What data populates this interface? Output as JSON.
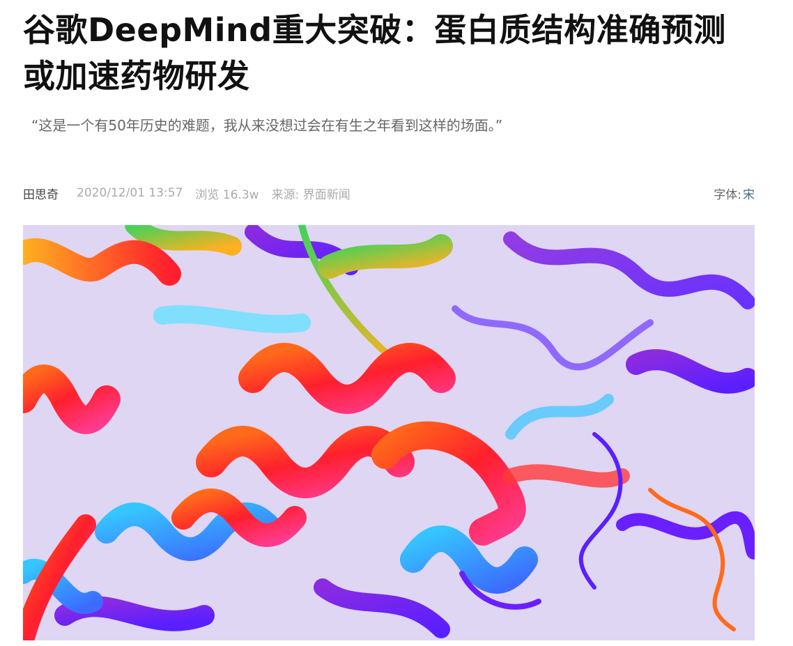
{
  "article": {
    "title": "谷歌DeepMind重大突破：蛋白质结构准确预测或加速药物研发",
    "subtitle": "“这是一个有50年历史的难题，我从来没想过会在有生之年看到这样的场面。”"
  },
  "meta": {
    "author": "田思奇",
    "datetime": "2020/12/01 13:57",
    "views_label": "浏览",
    "views": "16.3w",
    "source_label": "来源:",
    "source": "界面新闻",
    "font_label": "字体:",
    "font_value": "宋"
  },
  "hero_image": {
    "subject": "protein-ribbon-structure",
    "background_color": "#ded6f2",
    "colors": [
      "#ff1f2d",
      "#ff6a1a",
      "#ffb020",
      "#3fd35a",
      "#36c6ff",
      "#3b6cff",
      "#6a1fff",
      "#8a2be2"
    ]
  }
}
